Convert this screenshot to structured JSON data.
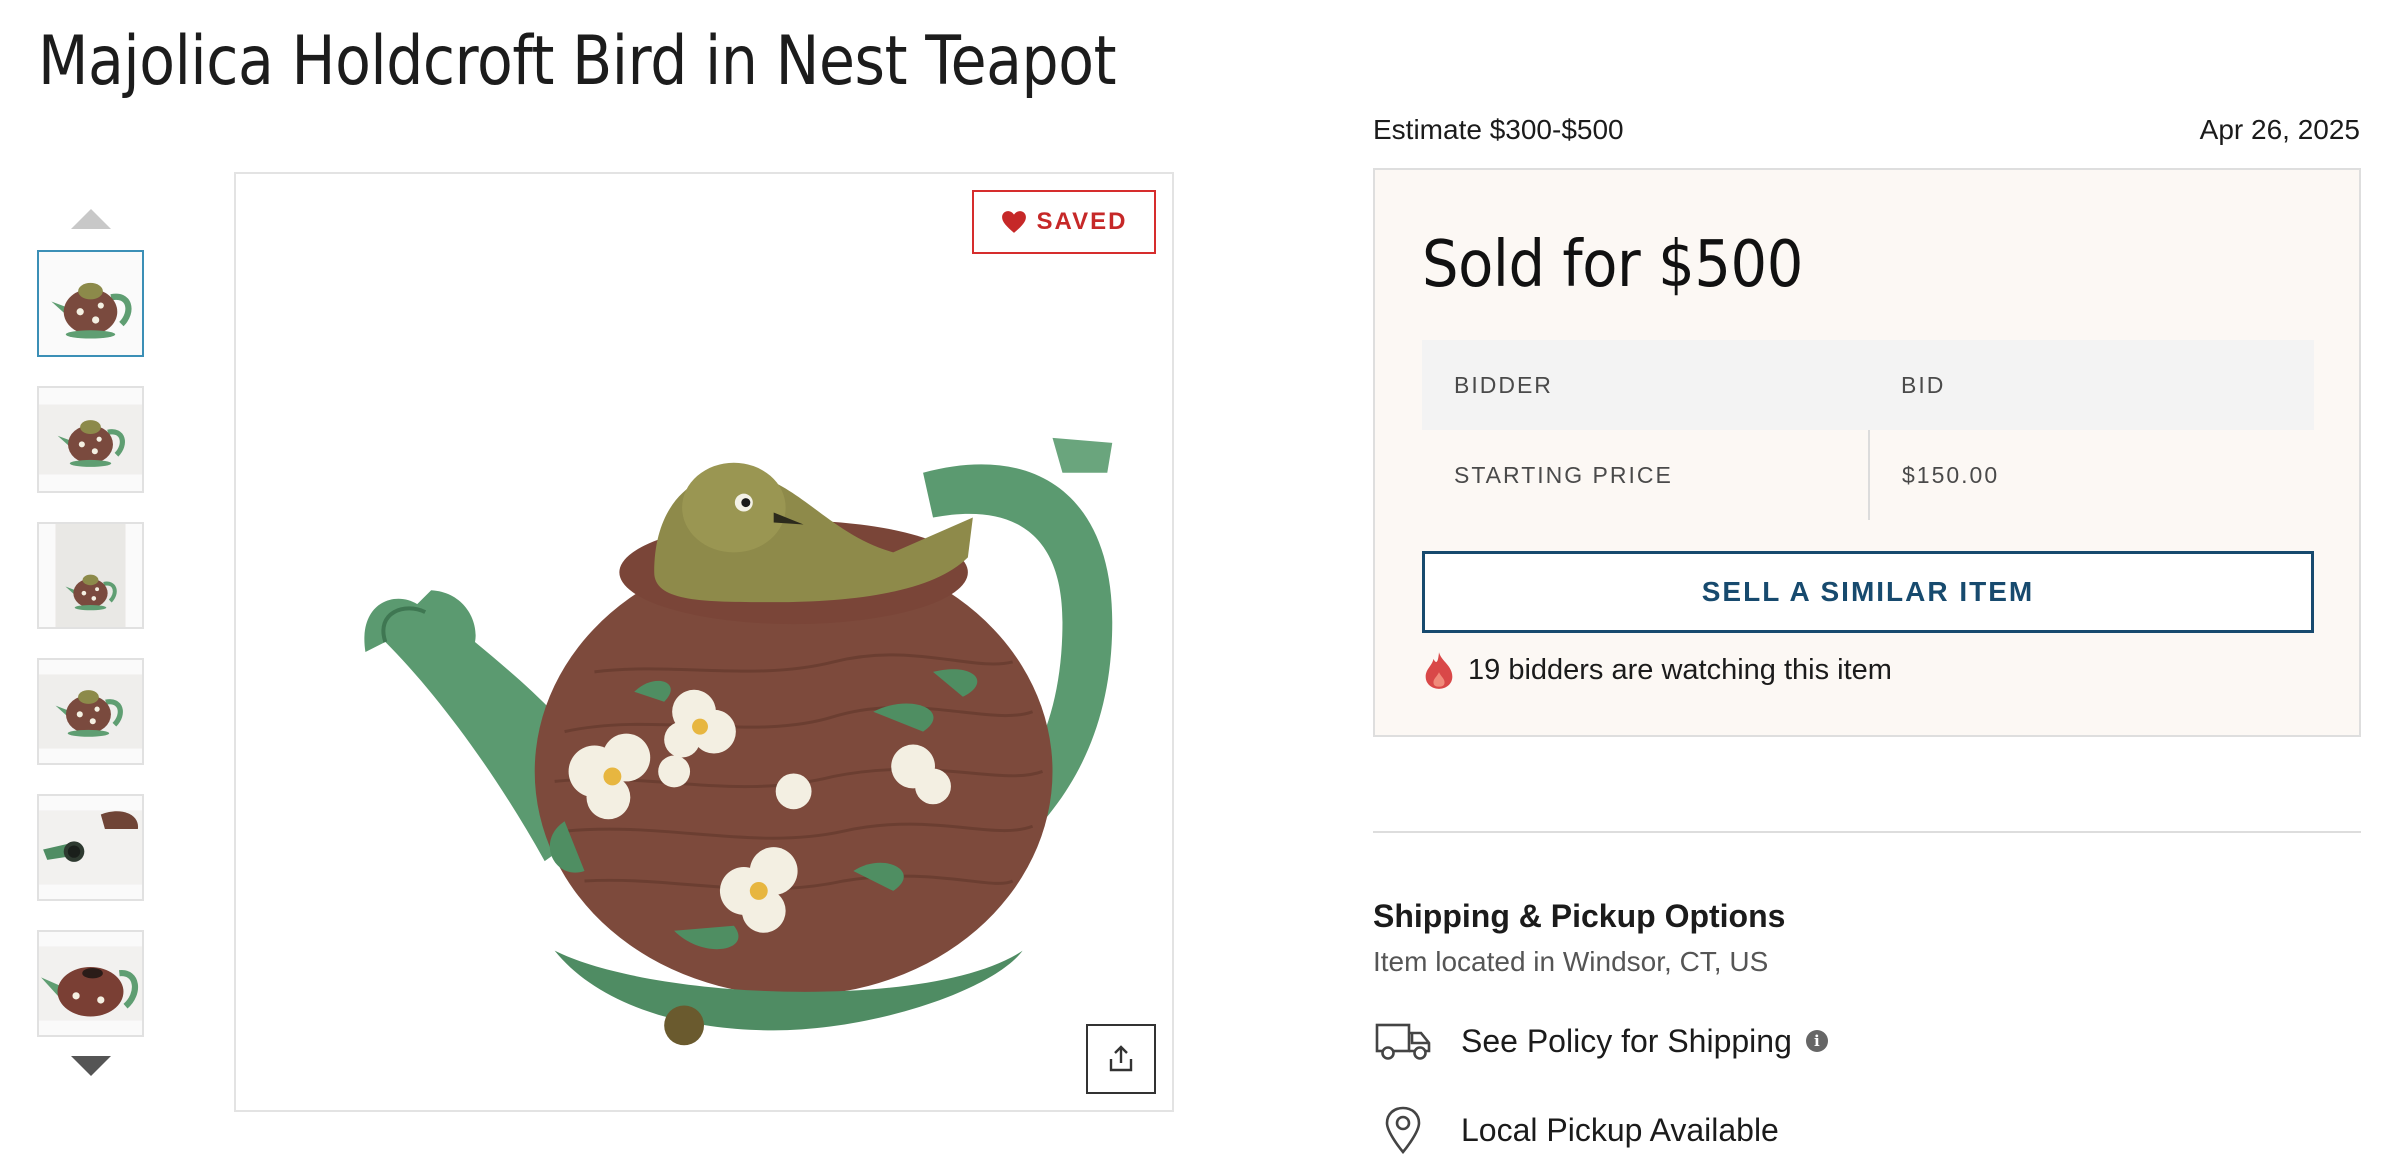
{
  "item": {
    "title": "Majolica Holdcroft Bird in Nest Teapot",
    "estimate": "Estimate $300-$500",
    "date": "Apr 26, 2025"
  },
  "gallery": {
    "saved_label": "SAVED",
    "thumbnail_count": 6,
    "active_thumbnail": 1
  },
  "sale": {
    "sold_text": "Sold for $500",
    "table_headers": [
      "BIDDER",
      "BID"
    ],
    "rows": [
      {
        "bidder": "STARTING PRICE",
        "bid": "$150.00"
      }
    ],
    "sell_button": "SELL A SIMILAR ITEM",
    "watching_text": "19 bidders are watching this item"
  },
  "shipping": {
    "heading": "Shipping & Pickup Options",
    "location": "Item located in Windsor, CT, US",
    "options": [
      "See Policy for Shipping",
      "Local Pickup Available"
    ]
  },
  "colors": {
    "accent_navy": "#174a6e",
    "saved_red": "#d62d2d",
    "sold_box_bg": "#fcf8f4",
    "thumb_active_border": "#3b8fb6"
  }
}
